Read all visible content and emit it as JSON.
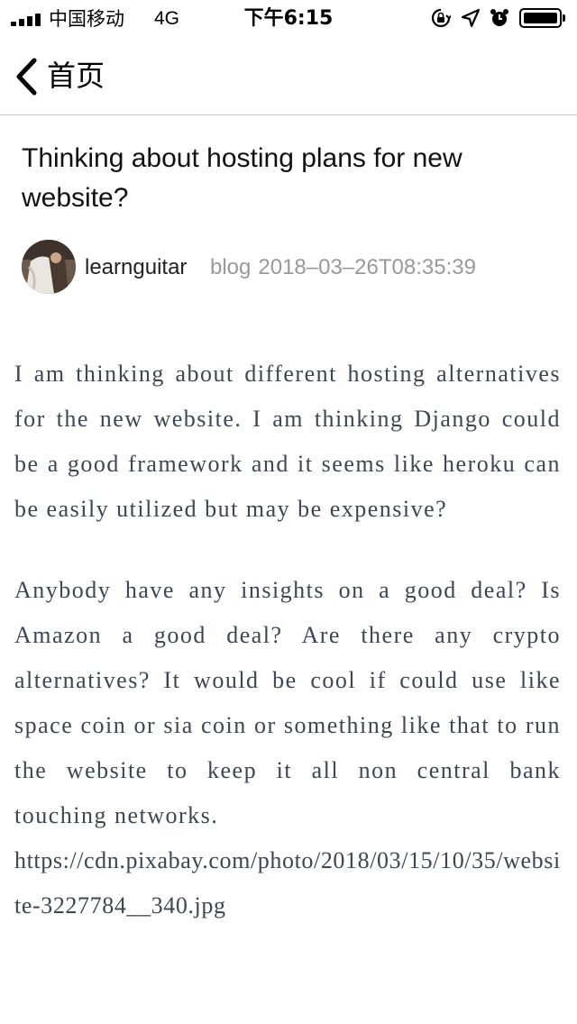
{
  "status_bar": {
    "carrier": "中国移动",
    "network": "4G",
    "time": "下午6:15",
    "icons": [
      "signal-icon",
      "orientation-lock-icon",
      "location-icon",
      "alarm-icon",
      "battery-icon"
    ]
  },
  "nav": {
    "back_label": "首页",
    "back_icon": "chevron-left-icon"
  },
  "post": {
    "title": "Thinking about hosting plans for new website?",
    "author": "learnguitar",
    "category": "blog",
    "timestamp": "2018–03–26T08:35:39",
    "paragraphs": [
      "I am thinking about different hosting alternatives for the new website. I am thinking Django could be a good framework and it seems like heroku can be easily utilized but may be expensive?",
      "Anybody have any insights on a good deal? Is Amazon a good deal? Are there any crypto alternatives? It would be cool if could use like space coin or sia coin or something like that to run the website to keep it all non central bank touching networks."
    ],
    "link": "https://cdn.pixabay.com/photo/2018/03/15/10/35/website-3227784__340.jpg"
  },
  "colors": {
    "body_text": "#3c4654",
    "meta_text": "#999999",
    "divider": "#c8c8c8"
  }
}
